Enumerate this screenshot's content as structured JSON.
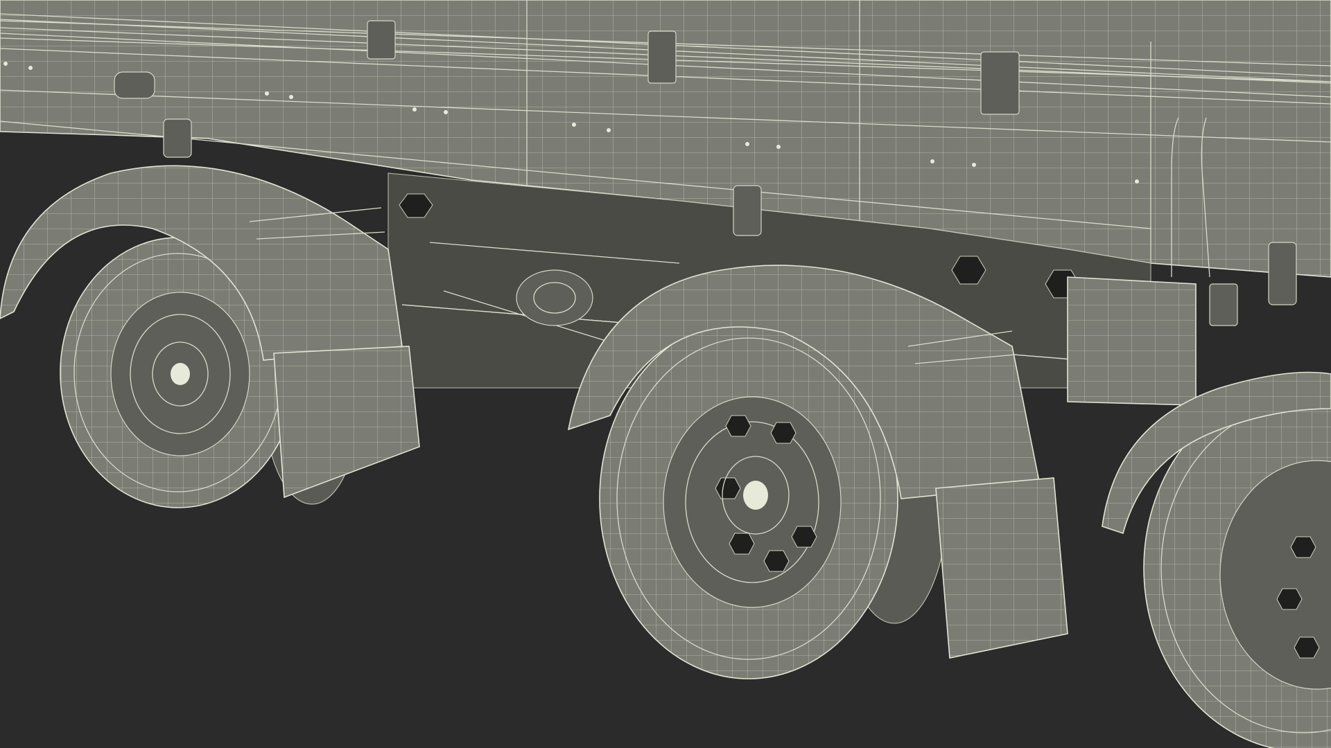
{
  "scene": {
    "background_color": "#2b2b2b",
    "model_color": "#7b7c74",
    "wire_color": "#d9dccb",
    "subject": "wireframe-truck-rear-axles",
    "visible_wheels": 3
  }
}
